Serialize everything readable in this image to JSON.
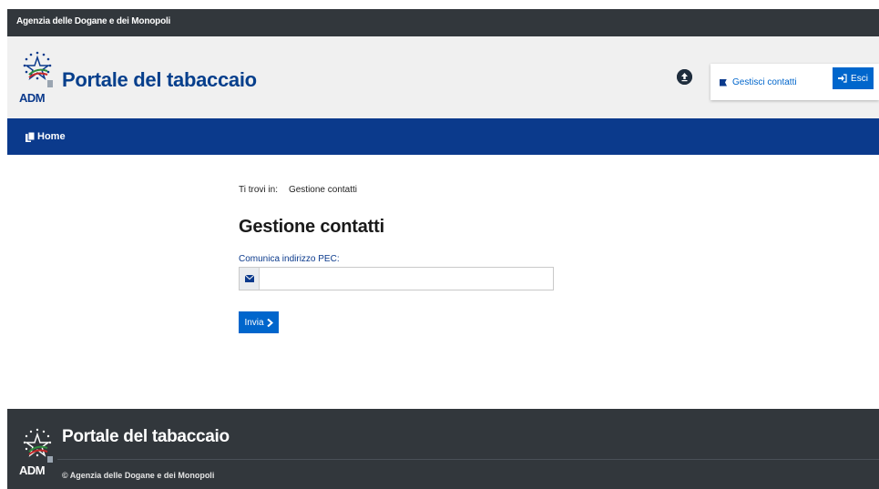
{
  "top_bar": {
    "title": "Agenzia delle Dogane e dei Monopoli"
  },
  "header": {
    "logo_text": "ADM",
    "title": "Portale del tabaccaio",
    "upload_icon": "upload-circle-icon",
    "contacts_link": "Gestisci contatti",
    "exit_label": "Esci"
  },
  "nav": {
    "home_label": "Home"
  },
  "main": {
    "breadcrumb_prefix": "Ti trovi in:",
    "breadcrumb_current": "Gestione contatti",
    "title": "Gestione contatti",
    "pec_label": "Comunica indirizzo PEC:",
    "pec_value": "",
    "pec_placeholder": "",
    "submit_label": "Invia"
  },
  "footer": {
    "logo_text": "ADM",
    "title": "Portale del tabaccaio",
    "copyright": "© Agenzia delle Dogane e dei Monopoli"
  },
  "colors": {
    "topbar": "#32373c",
    "header_bg": "#f0f0f0",
    "navbar": "#0b3a8c",
    "accent": "#0066cc",
    "footer": "#32373c"
  }
}
